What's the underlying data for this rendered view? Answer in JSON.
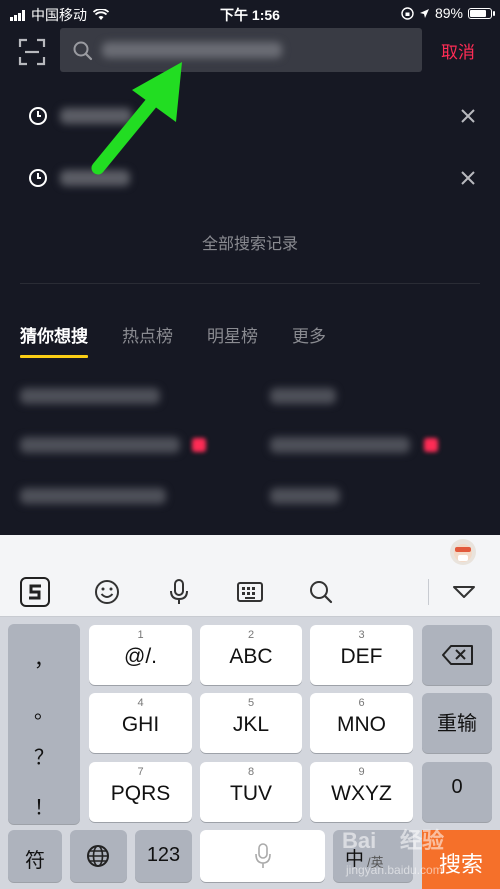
{
  "status_bar": {
    "carrier": "中国移动",
    "time": "下午 1:56",
    "battery": "89%"
  },
  "search": {
    "cancel_label": "取消",
    "icons": [
      "scan-icon",
      "search-icon"
    ]
  },
  "history": {
    "items": [
      {
        "icon": "clock-icon",
        "close_icon": "close-icon"
      },
      {
        "icon": "clock-icon",
        "close_icon": "close-icon"
      }
    ],
    "all_label": "全部搜索记录"
  },
  "tabs": [
    {
      "label": "猜你想搜",
      "active": true
    },
    {
      "label": "热点榜",
      "active": false
    },
    {
      "label": "明星榜",
      "active": false
    },
    {
      "label": "更多",
      "active": false
    }
  ],
  "keyboard": {
    "toolbar_icons": [
      "sogou-logo-icon",
      "emoji-icon",
      "microphone-icon",
      "keyboard-icon",
      "search-icon",
      "collapse-icon"
    ],
    "side_keys": [
      "，",
      "。",
      "？",
      "！"
    ],
    "keys_row1": [
      {
        "num": "1",
        "label": "@/."
      },
      {
        "num": "2",
        "label": "ABC"
      },
      {
        "num": "3",
        "label": "DEF"
      }
    ],
    "keys_row2": [
      {
        "num": "4",
        "label": "GHI"
      },
      {
        "num": "5",
        "label": "JKL"
      },
      {
        "num": "6",
        "label": "MNO"
      }
    ],
    "keys_row3": [
      {
        "num": "7",
        "label": "PQRS"
      },
      {
        "num": "8",
        "label": "TUV"
      },
      {
        "num": "9",
        "label": "WXYZ"
      }
    ],
    "reenter_label": "重输",
    "zero_label": "0",
    "fu_label": "符",
    "num_label": "123",
    "lang_label": "中",
    "lang_sub": "/英",
    "search_label": "搜索"
  },
  "colors": {
    "background": "#161823",
    "accent_red": "#fe2c55",
    "tab_underline": "#face15",
    "search_key": "#f5702a",
    "arrow": "#22dd22"
  }
}
